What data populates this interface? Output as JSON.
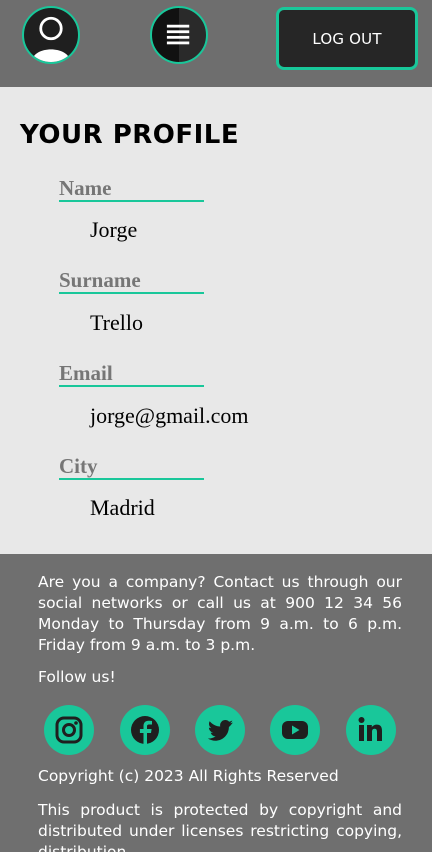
{
  "header": {
    "avatar_icon": "user-avatar-icon",
    "menu_icon": "hamburger-menu-icon",
    "logout_label": "LOG OUT"
  },
  "profile": {
    "title": "YOUR PROFILE",
    "fields": [
      {
        "label": "Name",
        "value": "Jorge"
      },
      {
        "label": "Surname",
        "value": "Trello"
      },
      {
        "label": "Email",
        "value": "jorge@gmail.com"
      },
      {
        "label": "City",
        "value": "Madrid"
      }
    ]
  },
  "footer": {
    "contact_text": "Are you a company? Contact us through our social networks or call us at 900 12 34 56 Monday to Thursday from 9 a.m. to 6 p.m. Friday from 9 a.m. to 3 p.m.",
    "follow_text": "Follow us!",
    "social_icons": [
      "instagram-icon",
      "facebook-icon",
      "twitter-icon",
      "youtube-icon",
      "linkedin-icon"
    ],
    "copyright": "Copyright (c) 2023 All Rights Reserved",
    "legal_text": "This product is protected by copyright and distributed under licenses restricting copying, distribution"
  },
  "colors": {
    "accent": "#19c79a",
    "header_bg": "#6e6e6e",
    "profile_bg": "#e8e8e8",
    "footer_bg": "#6f6f6f",
    "button_bg": "#262626"
  }
}
